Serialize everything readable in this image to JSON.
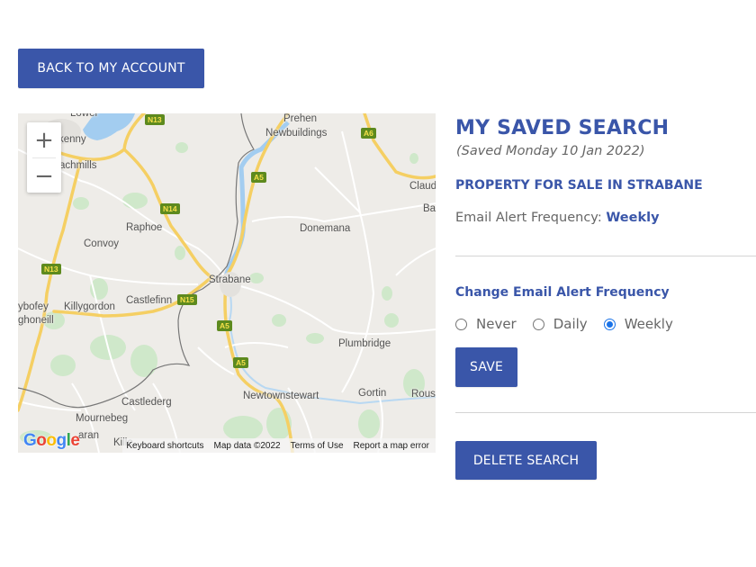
{
  "nav": {
    "back_label": "BACK TO MY ACCOUNT"
  },
  "saved_search": {
    "title": "MY SAVED SEARCH",
    "saved_date": "(Saved Monday 10 Jan 2022)",
    "search_name": "PROPERTY FOR SALE IN STRABANE",
    "frequency_label": "Email Alert Frequency:",
    "frequency_value": "Weekly"
  },
  "change_frequency": {
    "heading": "Change Email Alert Frequency",
    "options": [
      {
        "label": "Never",
        "checked": false
      },
      {
        "label": "Daily",
        "checked": false
      },
      {
        "label": "Weekly",
        "checked": true
      }
    ],
    "save_label": "SAVE"
  },
  "delete_label": "DELETE SEARCH",
  "map": {
    "zoom_in": "+",
    "zoom_out": "−",
    "places": {
      "lower": "Lower",
      "kenny": "kenny",
      "achmills": "achmills",
      "prehen": "Prehen",
      "newbuildings": "Newbuildings",
      "claud": "Claud",
      "ba": "Ba",
      "raphoe": "Raphoe",
      "convoy": "Convoy",
      "donemana": "Donemana",
      "strabane": "Strabane",
      "ybofey": "ybofey",
      "ghoneill": "ghoneill",
      "killygordon": "Killygordon",
      "castlefinn": "Castlefinn",
      "plumbridge": "Plumbridge",
      "castlederg": "Castlederg",
      "newtownstewart": "Newtownstewart",
      "gortin": "Gortin",
      "rous": "Rous",
      "mournebeg": "Mournebeg",
      "aran": "aran",
      "kille": "Kille"
    },
    "shields": {
      "n13_top": "N13",
      "a6": "A6",
      "a5_top": "A5",
      "n14": "N14",
      "n13_left": "N13",
      "n15": "N15",
      "a5_mid": "A5",
      "a5_low": "A5"
    },
    "footer": {
      "keyboard_shortcuts": "Keyboard shortcuts",
      "map_data": "Map data ©2022",
      "terms": "Terms of Use",
      "report": "Report a map error"
    },
    "logo_letters": [
      "G",
      "o",
      "o",
      "g",
      "l",
      "e"
    ],
    "colors": {
      "land": "#eeece8",
      "water": "#a3cdf0",
      "road": "#f7d26b",
      "park": "#c8e6c3",
      "border": "#666666"
    }
  },
  "colors": {
    "brand_blue": "#3a56a9",
    "radio_checked": "#1a73e8"
  }
}
